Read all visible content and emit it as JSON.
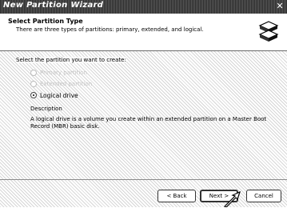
{
  "window": {
    "title": "New Partition Wizard",
    "close_glyph": "✕"
  },
  "header": {
    "title": "Select Partition Type",
    "subtitle": "There are three types of partitions: primary, extended, and logical.",
    "icon": "disk-stack-icon"
  },
  "body": {
    "prompt": "Select the partition you want to create:",
    "options": [
      {
        "label": "Primary partition",
        "enabled": false,
        "selected": false
      },
      {
        "label": "Extended partition",
        "enabled": false,
        "selected": false
      },
      {
        "label": "Logical drive",
        "enabled": true,
        "selected": true
      }
    ],
    "description_title": "Description",
    "description_text": "A logical drive is a volume you create within an extended partition on a Master Boot Record (MBR) basic disk."
  },
  "buttons": {
    "back": "< Back",
    "next": "Next >",
    "cancel": "Cancel"
  },
  "cursor": "mouse-pointer-icon"
}
